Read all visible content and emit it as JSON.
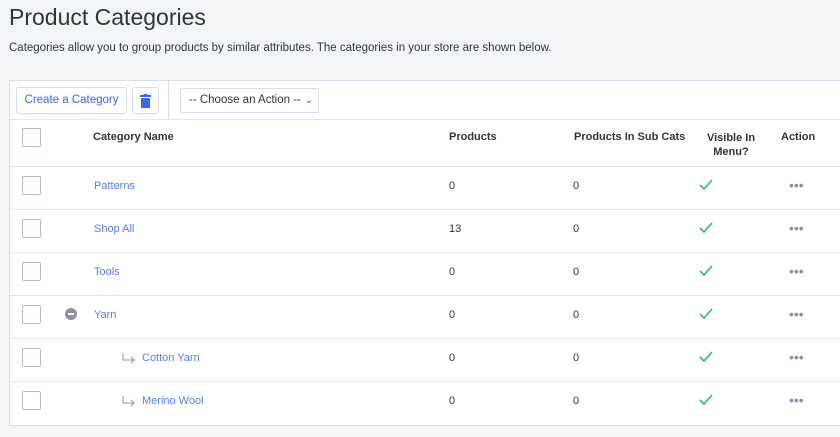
{
  "page": {
    "title": "Product Categories",
    "description": "Categories allow you to group products by similar attributes. The categories in your store are shown below."
  },
  "toolbar": {
    "create_label": "Create a Category",
    "trash_icon": "trash-icon",
    "action_select": "-- Choose an Action --"
  },
  "table": {
    "headers": {
      "name": "Category Name",
      "products": "Products",
      "sub_cats": "Products In Sub Cats",
      "visible": "Visible In Menu?",
      "action": "Action"
    },
    "rows": [
      {
        "name": "Patterns",
        "products": "0",
        "sub_cats": "0",
        "visible": true,
        "level": 0
      },
      {
        "name": "Shop All",
        "products": "13",
        "sub_cats": "0",
        "visible": true,
        "level": 0
      },
      {
        "name": "Tools",
        "products": "0",
        "sub_cats": "0",
        "visible": true,
        "level": 0
      },
      {
        "name": "Yarn",
        "products": "0",
        "sub_cats": "0",
        "visible": true,
        "level": 0,
        "collapsible": true
      },
      {
        "name": "Cotton Yarn",
        "products": "0",
        "sub_cats": "0",
        "visible": true,
        "level": 1
      },
      {
        "name": "Merino Wool",
        "products": "0",
        "sub_cats": "0",
        "visible": true,
        "level": 1
      }
    ]
  },
  "colors": {
    "link": "#5b7cf0",
    "accent": "#3c64f4",
    "check": "#2fba5e"
  }
}
